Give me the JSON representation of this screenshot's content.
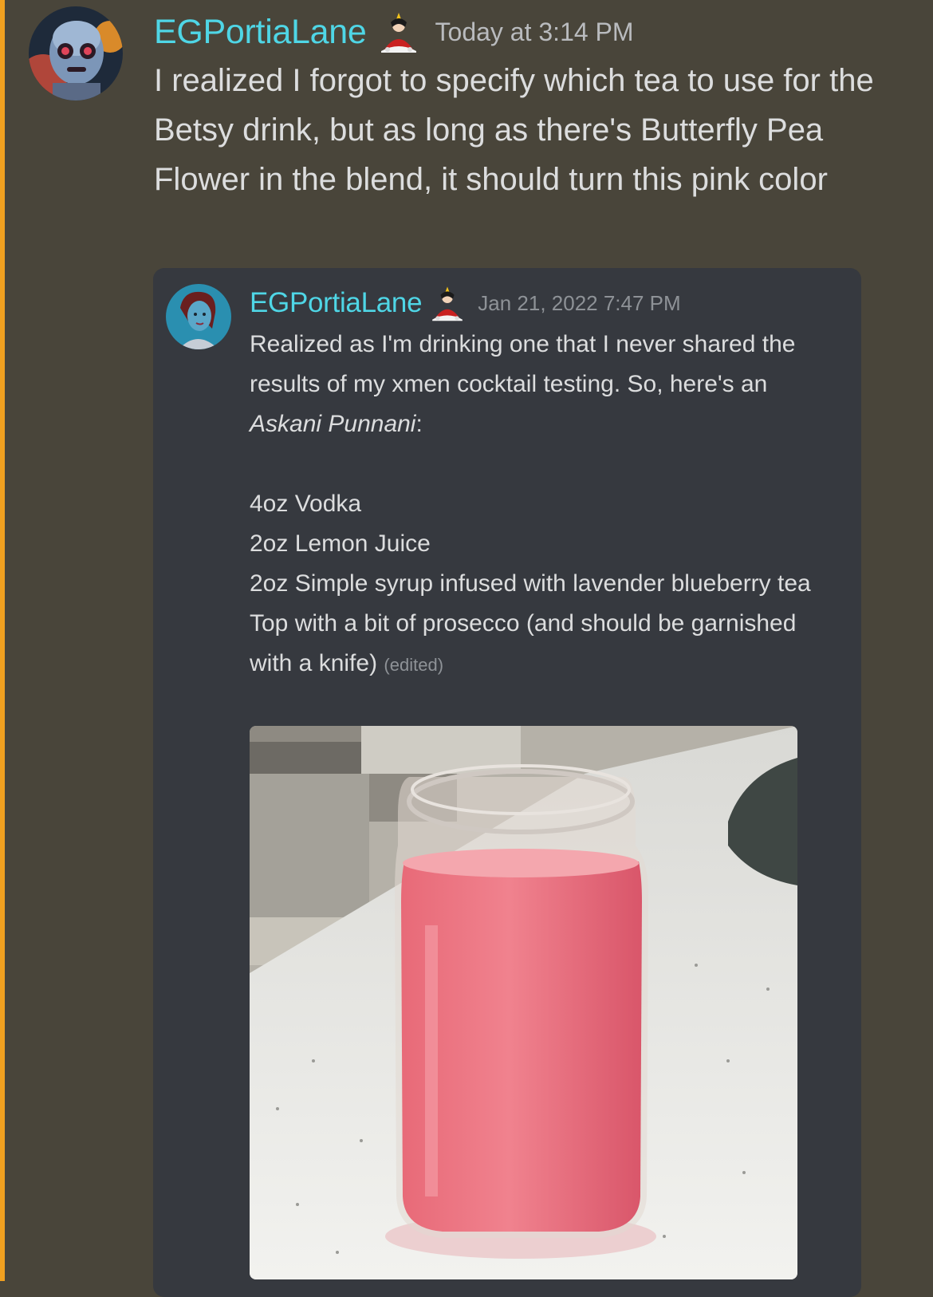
{
  "message": {
    "author": "EGPortiaLane",
    "role_icon": "cartoon-character-icon",
    "timestamp": "Today at 3:14 PM",
    "text": "I realized I forgot to specify which tea to use for the Betsy drink, but as long as there's Butterfly Pea Flower in the blend, it should turn this pink color"
  },
  "quoted": {
    "author": "EGPortiaLane",
    "role_icon": "cartoon-character-icon",
    "timestamp": "Jan 21, 2022 7:47 PM",
    "intro": "Realized as I'm drinking one that I never shared the results of my xmen cocktail testing. So, here's an",
    "drink_name": "Askani Punnani",
    "drink_suffix": ":",
    "ingredients": [
      "4oz Vodka",
      "2oz Lemon Juice",
      "2oz Simple syrup infused with lavender blueberry tea",
      "Top with a bit of prosecco (and should be garnished with a knife)"
    ],
    "edited_label": "(edited)"
  },
  "colors": {
    "background": "#49453a",
    "accent_bar": "#f0a020",
    "username": "#4fd6e6",
    "embed_bg": "#36393f"
  }
}
